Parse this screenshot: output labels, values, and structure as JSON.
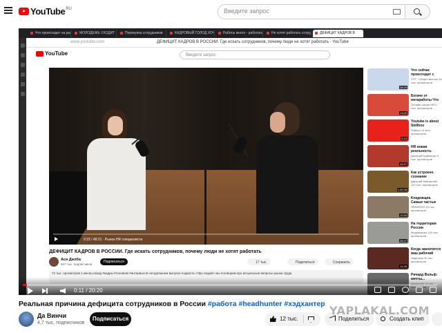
{
  "header": {
    "logo_text": "YouTube",
    "logo_region": "RU",
    "search_placeholder": "Введите запрос"
  },
  "inner_browser": {
    "tabs": [
      "Что происходит на рынке",
      "МОЛОДЕЖЬ УХОДИТ",
      "Перекупка сотрудников",
      "КАДРОВЫЙ ГОЛОД ХОЧ",
      "Работы много - работать",
      "Не хотят работать сотрудн",
      "ДЕФИЦИТ КАДРОВ В"
    ],
    "url": "www.youtube.com",
    "page_title": "ДЕФИЦИТ КАДРОВ В РОССИИ. Где искать сотрудников, почему люди не хотят работать - YouTube",
    "logo_text": "YouTube",
    "search_placeholder": "Введите запрос",
    "video_time": "0:15 / 48:21 · Рынок HR специалиста",
    "video_title": "ДЕФИЦИТ КАДРОВ В РОССИИ. Где искать сотрудников, почему люди не хотят работать",
    "channel_name": "Ася Дилба",
    "channel_subs": "627 тыс. подписчиков",
    "subscribe": "Подписаться",
    "likes": "17 тыс.",
    "share": "Поделиться",
    "save": "Сохранить",
    "description": "72 тыс. просмотров  1 месяц назад  #кадры #головняк #интервью\nВ сегодняшнем выпуске подкаста «Про людей» мы поговорим про актуальные вопросы рынка труда",
    "recommendations": [
      {
        "title": "Что сейчас происходит с рынком труда? Какие зарплаты",
        "meta": "VTP · Общественное\n54 тыс. просмотров",
        "duration": "28:29",
        "color": "#c9d8ea"
      },
      {
        "title": "Богаче от мегаработы Что ожидает...",
        "meta": "Онлайн-школа HR\n5 тыс. просмотров",
        "duration": "13:00",
        "color": "#d84a3a"
      },
      {
        "title": "Youtube is about Skillbox",
        "meta": "Skillbox\n14 млн просмотров",
        "duration": "5:15",
        "color": "#e8221b"
      },
      {
        "title": "HR новая реальность: мотивация, увольнение",
        "meta": "Дмитрий Кравченко\n5 тыс. просмотров",
        "duration": "43:37",
        "color": "#b23a2c"
      },
      {
        "title": "Как устроено сознание типичного китайца",
        "meta": "Дмитрий Вайнштейн\n120 тыс. просмотров",
        "duration": "1:09:38",
        "color": "#7a5a2a"
      },
      {
        "title": "Кладовщик. Самые частые собеседования",
        "meta": "HRINFEKS\n18 тыс. просмотров",
        "duration": "11:54",
        "color": "#8a7a66"
      },
      {
        "title": "На территории России действует...",
        "meta": "Медиаканал\n140 тыс. просмотров",
        "duration": "28:47",
        "color": "#9a9a96"
      },
      {
        "title": "Когда закончится ваш рабочий день?",
        "meta": "Неделька\n30 тыс. просмотров",
        "duration": "11:26",
        "color": "#5a2a22"
      },
      {
        "title": "Ричард Вольф: мечты...",
        "meta": "Дискуссия\n14 тыс. просмотров",
        "duration": "",
        "color": "#6a6a6a"
      }
    ]
  },
  "player": {
    "time": "0:11 / 20:20",
    "progress": 0.01
  },
  "video": {
    "title_main": "Реальная причина дефицита сотрудников в России ",
    "hashtags": "#работа #headhunter #хэдхантер"
  },
  "channel": {
    "name": "Да Винчи",
    "subscribers": "4,7 тыс. подписчиков",
    "subscribe_label": "Подписаться"
  },
  "actions": {
    "likes": "12 тыс.",
    "share_label": "Поделиться",
    "clip_label": "Создать клип"
  },
  "watermark": "YAPLAKAL.COM"
}
